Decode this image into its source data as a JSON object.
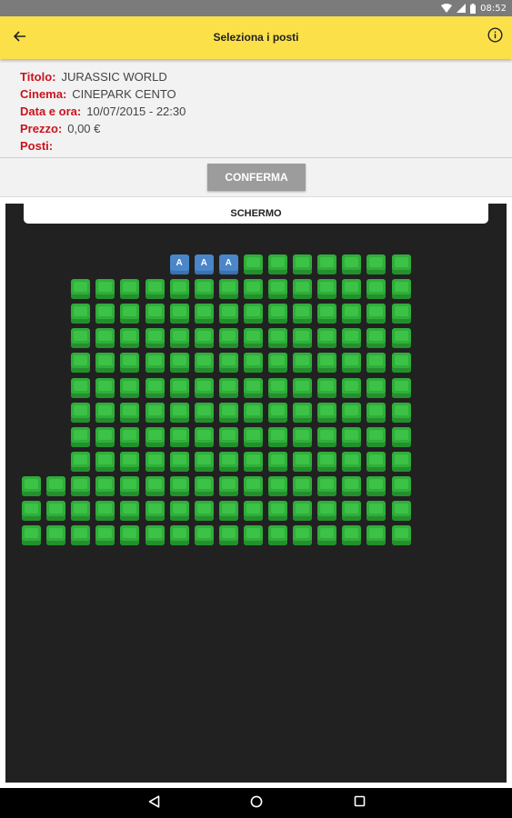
{
  "status_bar": {
    "time": "08:52"
  },
  "app_bar": {
    "title": "Seleziona i posti",
    "back_icon": "arrow-left-icon",
    "info_icon": "info-circle-icon"
  },
  "info": {
    "title_label": "Titolo:",
    "title_value": "JURASSIC WORLD",
    "cinema_label": "Cinema:",
    "cinema_value": "CINEPARK CENTO",
    "date_label": "Data e ora:",
    "date_value": "10/07/2015 - 22:30",
    "price_label": "Prezzo:",
    "price_value": "0,00 €",
    "seats_label": "Posti:",
    "seats_value": ""
  },
  "confirm": {
    "label": "CONFERMA"
  },
  "seat_map": {
    "screen_label": "SCHERMO",
    "free_color": "#2fae3a",
    "taken_color": "#4a86c9",
    "taken_mark": "A",
    "columns_count": 16,
    "rows": [
      {
        "row": 1,
        "cols": [
          10,
          11,
          12,
          13,
          14,
          15,
          16
        ],
        "taken": [
          7,
          8,
          9
        ]
      },
      {
        "row": 2,
        "cols": [
          3,
          4,
          5,
          6,
          7,
          8,
          9,
          10,
          11,
          12,
          13,
          14,
          15,
          16
        ],
        "taken": []
      },
      {
        "row": 3,
        "cols": [
          3,
          4,
          5,
          6,
          7,
          8,
          9,
          10,
          11,
          12,
          13,
          14,
          15,
          16
        ],
        "taken": []
      },
      {
        "row": 4,
        "cols": [
          3,
          4,
          5,
          6,
          7,
          8,
          9,
          10,
          11,
          12,
          13,
          14,
          15,
          16
        ],
        "taken": []
      },
      {
        "row": 5,
        "cols": [
          3,
          4,
          5,
          6,
          7,
          8,
          9,
          10,
          11,
          12,
          13,
          14,
          15,
          16
        ],
        "taken": []
      },
      {
        "row": 6,
        "cols": [
          3,
          4,
          5,
          6,
          7,
          8,
          9,
          10,
          11,
          12,
          13,
          14,
          15,
          16
        ],
        "taken": []
      },
      {
        "row": 7,
        "cols": [
          3,
          4,
          5,
          6,
          7,
          8,
          9,
          10,
          11,
          12,
          13,
          14,
          15,
          16
        ],
        "taken": []
      },
      {
        "row": 8,
        "cols": [
          3,
          4,
          5,
          6,
          7,
          8,
          9,
          10,
          11,
          12,
          13,
          14,
          15,
          16
        ],
        "taken": []
      },
      {
        "row": 9,
        "cols": [
          3,
          4,
          5,
          6,
          7,
          8,
          9,
          10,
          11,
          12,
          13,
          14,
          15,
          16
        ],
        "taken": []
      },
      {
        "row": 10,
        "cols": [
          1,
          2,
          3,
          4,
          5,
          6,
          7,
          8,
          9,
          10,
          11,
          12,
          13,
          14,
          15,
          16
        ],
        "taken": []
      },
      {
        "row": 11,
        "cols": [
          1,
          2,
          3,
          4,
          5,
          6,
          7,
          8,
          9,
          10,
          11,
          12,
          13,
          14,
          15,
          16
        ],
        "taken": []
      },
      {
        "row": 12,
        "cols": [
          1,
          2,
          3,
          4,
          5,
          6,
          7,
          8,
          9,
          10,
          11,
          12,
          13,
          14,
          15,
          16
        ],
        "taken": []
      }
    ]
  },
  "nav_bar": {
    "back_icon": "triangle-back-icon",
    "home_icon": "circle-home-icon",
    "recents_icon": "square-recents-icon"
  }
}
